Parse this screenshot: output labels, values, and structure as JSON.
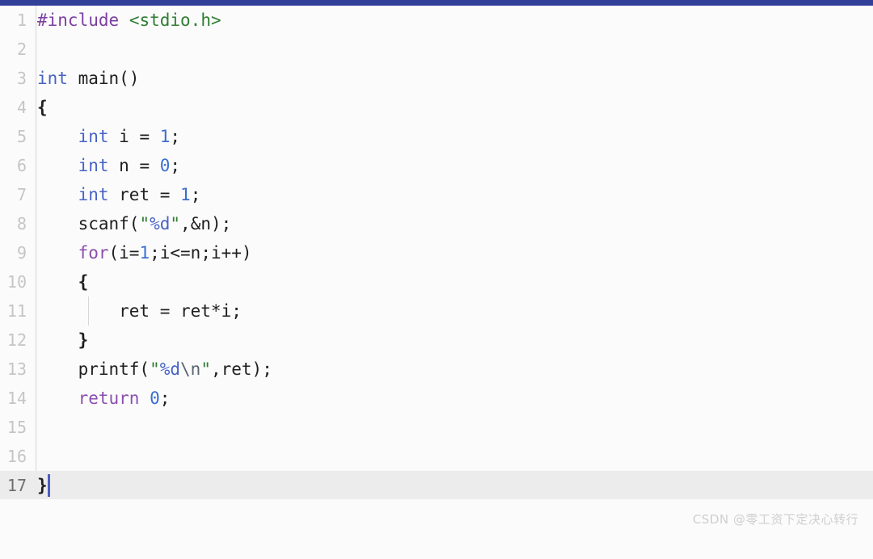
{
  "window": {
    "accent_color": "#323f99",
    "background_color": "#fbfbfb",
    "active_line_color": "#ececec",
    "caret_color": "#4a5ec4",
    "gutter_color": "#c5c5c5"
  },
  "editor": {
    "language": "C",
    "active_line_number": 17,
    "total_lines": 17,
    "lines": [
      {
        "number": "1",
        "tokens": [
          {
            "text": "#include",
            "cls": "t-pre"
          },
          {
            "text": " ",
            "cls": "t-plain"
          },
          {
            "text": "<stdio.h>",
            "cls": "t-header"
          }
        ]
      },
      {
        "number": "2",
        "tokens": []
      },
      {
        "number": "3",
        "tokens": [
          {
            "text": "int",
            "cls": "t-kw-type"
          },
          {
            "text": " main()",
            "cls": "t-plain"
          }
        ]
      },
      {
        "number": "4",
        "tokens": [
          {
            "text": "{",
            "cls": "t-brace"
          }
        ]
      },
      {
        "number": "5",
        "tokens": [
          {
            "text": "    ",
            "cls": "t-plain"
          },
          {
            "text": "int",
            "cls": "t-kw-type"
          },
          {
            "text": " i = ",
            "cls": "t-plain"
          },
          {
            "text": "1",
            "cls": "t-num"
          },
          {
            "text": ";",
            "cls": "t-plain"
          }
        ]
      },
      {
        "number": "6",
        "tokens": [
          {
            "text": "    ",
            "cls": "t-plain"
          },
          {
            "text": "int",
            "cls": "t-kw-type"
          },
          {
            "text": " n = ",
            "cls": "t-plain"
          },
          {
            "text": "0",
            "cls": "t-num"
          },
          {
            "text": ";",
            "cls": "t-plain"
          }
        ]
      },
      {
        "number": "7",
        "tokens": [
          {
            "text": "    ",
            "cls": "t-plain"
          },
          {
            "text": "int",
            "cls": "t-kw-type"
          },
          {
            "text": " ret = ",
            "cls": "t-plain"
          },
          {
            "text": "1",
            "cls": "t-num"
          },
          {
            "text": ";",
            "cls": "t-plain"
          }
        ]
      },
      {
        "number": "8",
        "tokens": [
          {
            "text": "    scanf(",
            "cls": "t-plain"
          },
          {
            "text": "\"",
            "cls": "t-str"
          },
          {
            "text": "%d",
            "cls": "t-fmt"
          },
          {
            "text": "\"",
            "cls": "t-str"
          },
          {
            "text": ",&n);",
            "cls": "t-plain"
          }
        ]
      },
      {
        "number": "9",
        "tokens": [
          {
            "text": "    ",
            "cls": "t-plain"
          },
          {
            "text": "for",
            "cls": "t-kw-ctrl"
          },
          {
            "text": "(i=",
            "cls": "t-plain"
          },
          {
            "text": "1",
            "cls": "t-num"
          },
          {
            "text": ";i<=n;i++)",
            "cls": "t-plain"
          }
        ]
      },
      {
        "number": "10",
        "tokens": [
          {
            "text": "    ",
            "cls": "t-plain"
          },
          {
            "text": "{",
            "cls": "t-brace"
          }
        ]
      },
      {
        "number": "11",
        "tokens": [
          {
            "text": "        ret = ret*i;",
            "cls": "t-plain"
          }
        ],
        "inner_guide": true
      },
      {
        "number": "12",
        "tokens": [
          {
            "text": "    ",
            "cls": "t-plain"
          },
          {
            "text": "}",
            "cls": "t-brace"
          }
        ]
      },
      {
        "number": "13",
        "tokens": [
          {
            "text": "    printf(",
            "cls": "t-plain"
          },
          {
            "text": "\"",
            "cls": "t-str"
          },
          {
            "text": "%d",
            "cls": "t-fmt"
          },
          {
            "text": "\\n",
            "cls": "t-esc"
          },
          {
            "text": "\"",
            "cls": "t-str"
          },
          {
            "text": ",ret);",
            "cls": "t-plain"
          }
        ]
      },
      {
        "number": "14",
        "tokens": [
          {
            "text": "    ",
            "cls": "t-plain"
          },
          {
            "text": "return",
            "cls": "t-kw-ctrl"
          },
          {
            "text": " ",
            "cls": "t-plain"
          },
          {
            "text": "0",
            "cls": "t-num"
          },
          {
            "text": ";",
            "cls": "t-plain"
          }
        ]
      },
      {
        "number": "15",
        "tokens": []
      },
      {
        "number": "16",
        "tokens": []
      },
      {
        "number": "17",
        "tokens": [
          {
            "text": "}",
            "cls": "t-brace"
          }
        ],
        "active": true,
        "caret_after": true
      }
    ],
    "source_text": "#include <stdio.h>\n\nint main()\n{\n    int i = 1;\n    int n = 0;\n    int ret = 1;\n    scanf(\"%d\",&n);\n    for(i=1;i<=n;i++)\n    {\n        ret = ret*i;\n    }\n    printf(\"%d\\n\",ret);\n    return 0;\n\n\n}"
  },
  "watermark": {
    "text": "CSDN @零工资下定决心转行"
  }
}
